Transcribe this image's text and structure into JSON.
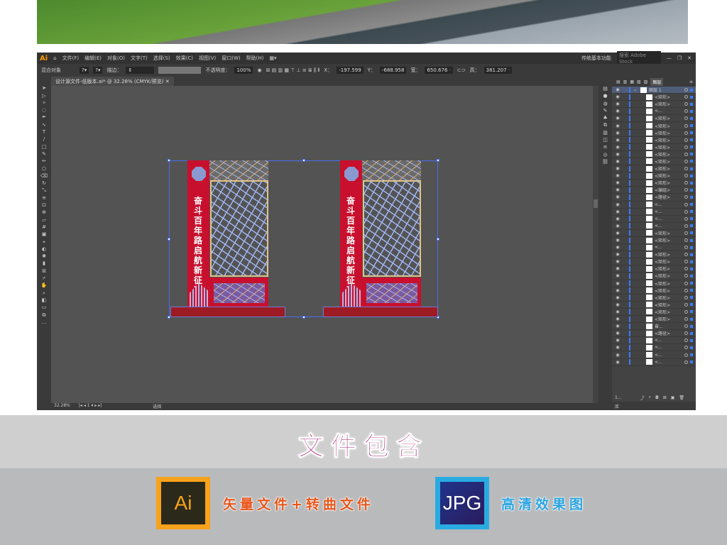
{
  "app": {
    "logo": "Ai",
    "menu": [
      "文件(F)",
      "编辑(E)",
      "对象(O)",
      "文字(T)",
      "选择(S)",
      "效果(C)",
      "视图(V)",
      "窗口(W)",
      "帮助(H)"
    ],
    "workspace": "传统基本功能",
    "search_placeholder": "搜索 Adobe Stock"
  },
  "control": {
    "selection": "混合对象",
    "stroke_label": "描边：",
    "opacity_label": "不透明度：",
    "opacity": "100%",
    "x_label": "X：",
    "x": "-197.599",
    "y_label": "Y：",
    "y": "-688.958",
    "w_label": "宽：",
    "w": "650.676 ·",
    "h_label": "高：",
    "h": "381.207 ·"
  },
  "document": {
    "tab": "设计源文件-低版本.ai* @ 32.28% (CMYK/预览)",
    "zoom": "32.28%",
    "artboard": "1",
    "status": "选择"
  },
  "artwork": {
    "slogan": "奋斗百年路 启航新征程"
  },
  "layers_panel": {
    "tab": "图层",
    "layer_name": "图层 1",
    "items": [
      "<矩形>",
      "<矩形>",
      "<...",
      "<矩形>",
      "<矩形>",
      "<矩形>",
      "<矩形>",
      "<矩形>",
      "<矩形>",
      "<矩形>",
      "<矩形>",
      "<矩形>",
      "<矩形>",
      "<编组>",
      "<路径>",
      "<...",
      "<...",
      "<...",
      "<...",
      "<矩形>",
      "<矩形>",
      "<...",
      "<矩形>",
      "<矩形>",
      "<矩形>",
      "<矩形>",
      "<矩形>",
      "<矩形>",
      "<矩形>",
      "<矩形>",
      "<矩形>",
      "<矩形>",
      "奋...",
      "<路径>",
      "<...",
      "<...",
      "<...",
      "<..."
    ],
    "footer": "1...",
    "library": "库"
  },
  "promo": {
    "title": "文件包含",
    "ai_badge": "Ai",
    "ai_caption": "矢量文件+转曲文件",
    "jpg_badge": "JPG",
    "jpg_caption": "高清效果图"
  },
  "colors": {
    "accent_magenta": "#a3106c",
    "ai_orange": "#f7a21b",
    "jpg_blue": "#29abe2",
    "pillar_red": "#c8102e"
  }
}
